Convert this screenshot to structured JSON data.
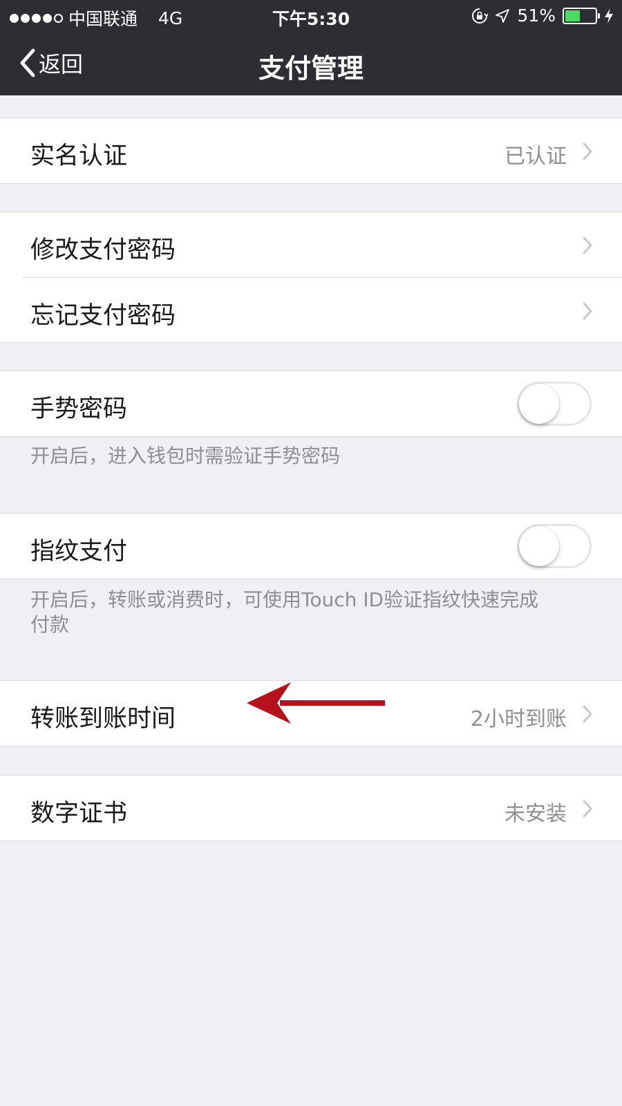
{
  "status_bar": {
    "carrier": "中国联通",
    "network": "4G",
    "time": "下午5:30",
    "battery": "51%",
    "battery_level": 0.51
  },
  "nav": {
    "back_label": "返回",
    "title": "支付管理"
  },
  "rows": {
    "real_name": {
      "label": "实名认证",
      "detail": "已认证"
    },
    "change_password": {
      "label": "修改支付密码"
    },
    "forgot_password": {
      "label": "忘记支付密码"
    },
    "gesture_password": {
      "label": "手势密码",
      "enabled": false,
      "note": "开启后，进入钱包时需验证手势密码"
    },
    "fingerprint": {
      "label": "指纹支付",
      "enabled": false,
      "note_line1": "开启后，转账或消费时，可使用Touch ID验证指纹快速完成",
      "note_line2": "付款"
    },
    "transfer_time": {
      "label": "转账到账时间",
      "detail": "2小时到账"
    },
    "certificate": {
      "label": "数字证书",
      "detail": "未安装"
    }
  },
  "colors": {
    "nav_background": "#2e2d33",
    "page_background": "#efeff4",
    "battery_fill": "#4cd964",
    "arrow": "#b5121b"
  }
}
